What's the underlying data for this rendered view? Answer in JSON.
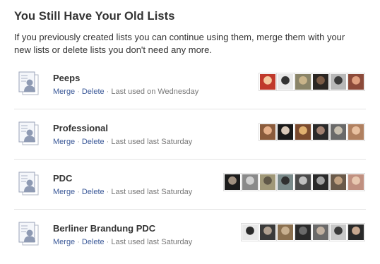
{
  "page": {
    "title": "You Still Have Your Old Lists",
    "description": "If you previously created lists you can continue using them, merge them with your new lists or delete lists you don't need any more."
  },
  "actions": {
    "merge_label": "Merge",
    "delete_label": "Delete",
    "separator": "·"
  },
  "lists": [
    {
      "name": "Peeps",
      "last_used": "Last used on Wednesday",
      "avatars": [
        {
          "bg": "#c0392b",
          "fg": "#f5c9a0"
        },
        {
          "bg": "#e8e8e8",
          "fg": "#333333"
        },
        {
          "bg": "#8a8468",
          "fg": "#c9b48a"
        },
        {
          "bg": "#2b2623",
          "fg": "#7a5a45"
        },
        {
          "bg": "#b8b8b8",
          "fg": "#3a3a3a"
        },
        {
          "bg": "#8c4a3a",
          "fg": "#e0a080"
        }
      ]
    },
    {
      "name": "Professional",
      "last_used": "Last used last Saturday",
      "avatars": [
        {
          "bg": "#8a5b3c",
          "fg": "#e6b08a"
        },
        {
          "bg": "#1a1a1a",
          "fg": "#d8c8b8"
        },
        {
          "bg": "#7a4a2e",
          "fg": "#e0b070"
        },
        {
          "bg": "#2a2a2a",
          "fg": "#a08070"
        },
        {
          "bg": "#6a6a6a",
          "fg": "#c8c0b0"
        },
        {
          "bg": "#b08060",
          "fg": "#e8c0a0"
        }
      ]
    },
    {
      "name": "PDC",
      "last_used": "Last used last Saturday",
      "avatars": [
        {
          "bg": "#1c1c1c",
          "fg": "#a09080"
        },
        {
          "bg": "#8a8a8a",
          "fg": "#d0d0d0"
        },
        {
          "bg": "#a09878",
          "fg": "#605848"
        },
        {
          "bg": "#7a8a8a",
          "fg": "#303030"
        },
        {
          "bg": "#4a4a4a",
          "fg": "#c0c0c0"
        },
        {
          "bg": "#2a2a2a",
          "fg": "#a0a0a0"
        },
        {
          "bg": "#6a5a4a",
          "fg": "#c0a080"
        },
        {
          "bg": "#c09080",
          "fg": "#e8c8b0"
        }
      ]
    },
    {
      "name": "Berliner Brandung PDC",
      "last_used": "Last used last Saturday",
      "avatars": [
        {
          "bg": "#e8e8e8",
          "fg": "#2a2a2a"
        },
        {
          "bg": "#3a3a3a",
          "fg": "#b0a090"
        },
        {
          "bg": "#8a7050",
          "fg": "#c8b090"
        },
        {
          "bg": "#2a2a2a",
          "fg": "#6a6a6a"
        },
        {
          "bg": "#6a6a6a",
          "fg": "#c0b0a0"
        },
        {
          "bg": "#c8c8c8",
          "fg": "#3a3a3a"
        },
        {
          "bg": "#2a2a2a",
          "fg": "#c8a890"
        }
      ]
    }
  ]
}
